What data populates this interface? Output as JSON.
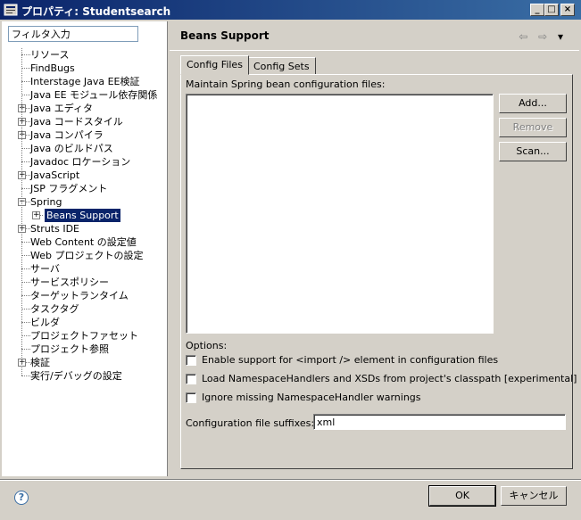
{
  "window": {
    "title": "プロパティ: Studentsearch",
    "min_glyph": "_",
    "max_glyph": "□",
    "close_glyph": "×"
  },
  "left": {
    "filter_value": "フィルタ入力",
    "tree": [
      {
        "label": "リソース",
        "level": 0,
        "expandable": false
      },
      {
        "label": "FindBugs",
        "level": 0,
        "expandable": false
      },
      {
        "label": "Interstage Java EE検証",
        "level": 0,
        "expandable": false
      },
      {
        "label": "Java EE モジュール依存関係",
        "level": 0,
        "expandable": false
      },
      {
        "label": "Java エディタ",
        "level": 0,
        "expandable": true,
        "expanded": false
      },
      {
        "label": "Java コードスタイル",
        "level": 0,
        "expandable": true,
        "expanded": false
      },
      {
        "label": "Java コンパイラ",
        "level": 0,
        "expandable": true,
        "expanded": false
      },
      {
        "label": "Java のビルドパス",
        "level": 0,
        "expandable": false
      },
      {
        "label": "Javadoc ロケーション",
        "level": 0,
        "expandable": false
      },
      {
        "label": "JavaScript",
        "level": 0,
        "expandable": true,
        "expanded": false
      },
      {
        "label": "JSP フラグメント",
        "level": 0,
        "expandable": false
      },
      {
        "label": "Spring",
        "level": 0,
        "expandable": true,
        "expanded": true
      },
      {
        "label": "Beans Support",
        "level": 1,
        "expandable": true,
        "expanded": false,
        "selected": true
      },
      {
        "label": "Struts IDE",
        "level": 0,
        "expandable": true,
        "expanded": false
      },
      {
        "label": "Web Content の設定値",
        "level": 0,
        "expandable": false
      },
      {
        "label": "Web プロジェクトの設定",
        "level": 0,
        "expandable": false
      },
      {
        "label": "サーバ",
        "level": 0,
        "expandable": false
      },
      {
        "label": "サービスポリシー",
        "level": 0,
        "expandable": false
      },
      {
        "label": "ターゲットランタイム",
        "level": 0,
        "expandable": false
      },
      {
        "label": "タスクタグ",
        "level": 0,
        "expandable": false
      },
      {
        "label": "ビルダ",
        "level": 0,
        "expandable": false
      },
      {
        "label": "プロジェクトファセット",
        "level": 0,
        "expandable": false
      },
      {
        "label": "プロジェクト参照",
        "level": 0,
        "expandable": false
      },
      {
        "label": "検証",
        "level": 0,
        "expandable": true,
        "expanded": false
      },
      {
        "label": "実行/デバッグの設定",
        "level": 0,
        "expandable": false
      }
    ]
  },
  "right": {
    "title": "Beans Support",
    "nav": {
      "back": "⇦",
      "forward": "⇨",
      "menu": "▾"
    },
    "tabs": [
      {
        "label": "Config Files",
        "active": true
      },
      {
        "label": "Config Sets",
        "active": false
      }
    ],
    "maintain_label": "Maintain Spring bean configuration files:",
    "buttons": {
      "add": "Add...",
      "remove": "Remove",
      "scan": "Scan..."
    },
    "options_label": "Options:",
    "options": [
      {
        "label": "Enable support for <import /> element in configuration files",
        "checked": false
      },
      {
        "label": "Load NamespaceHandlers and XSDs from project's classpath [experimental]",
        "checked": false
      },
      {
        "label": "Ignore missing NamespaceHandler warnings",
        "checked": false
      }
    ],
    "suffix_label": "Configuration file suffixes:",
    "suffix_value": "xml"
  },
  "footer": {
    "help": "?",
    "ok": "OK",
    "cancel": "キャンセル"
  }
}
